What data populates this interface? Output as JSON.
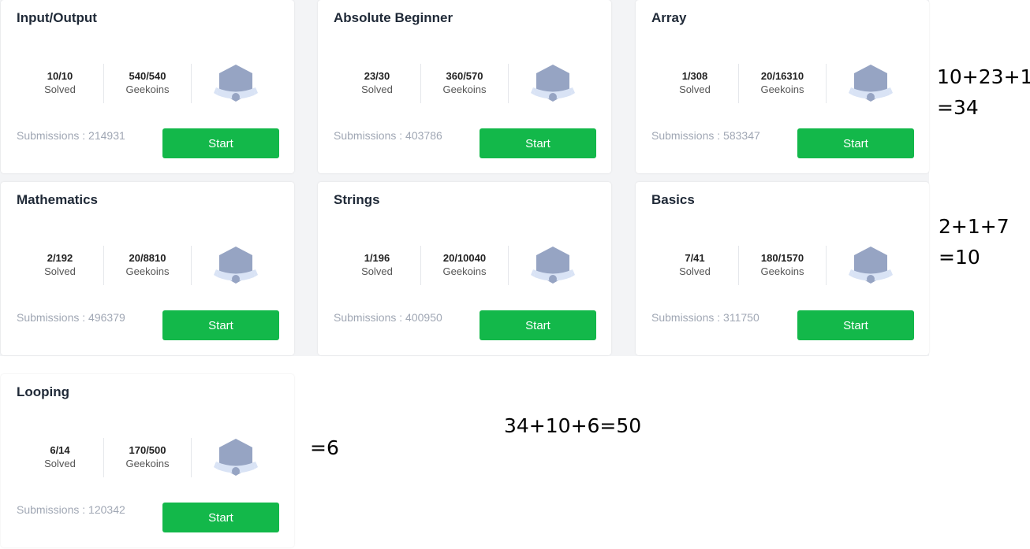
{
  "stat_labels": {
    "solved": "Solved",
    "coins": "Geekoins"
  },
  "subs_prefix": "Submissions : ",
  "start_label": "Start",
  "colors": {
    "start_button": "#13b84a",
    "badge": "#96a4c3",
    "ribbon": "#d9e3f5",
    "title": "#1f2937"
  },
  "cards": [
    {
      "title": "Input/Output",
      "solved": "10/10",
      "coins": "540/540",
      "submissions": "214931"
    },
    {
      "title": "Absolute Beginner",
      "solved": "23/30",
      "coins": "360/570",
      "submissions": "403786"
    },
    {
      "title": "Array",
      "solved": "1/308",
      "coins": "20/16310",
      "submissions": "583347"
    },
    {
      "title": "Mathematics",
      "solved": "2/192",
      "coins": "20/8810",
      "submissions": "496379"
    },
    {
      "title": "Strings",
      "solved": "1/196",
      "coins": "20/10040",
      "submissions": "400950"
    },
    {
      "title": "Basics",
      "solved": "7/41",
      "coins": "180/1570",
      "submissions": "311750"
    },
    {
      "title": "Looping",
      "solved": "6/14",
      "coins": "170/500",
      "submissions": "120342"
    }
  ],
  "annotations": {
    "row1_line1": "10+23+1",
    "row1_line2": "=34",
    "row2_line1": "2+1+7",
    "row2_line2": "=10",
    "row3": "=6",
    "total": "34+10+6=50"
  }
}
